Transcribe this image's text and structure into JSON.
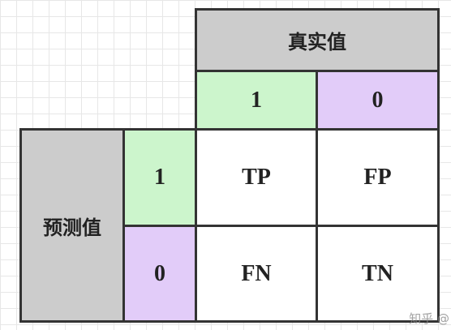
{
  "diagram": {
    "actual_header": "真实值",
    "predicted_header": "预测值",
    "actual_labels": [
      "1",
      "0"
    ],
    "predicted_labels": [
      "1",
      "0"
    ],
    "cells": {
      "tp": "TP",
      "fp": "FP",
      "fn": "FN",
      "tn": "TN"
    },
    "colors": {
      "header_fill": "#cccccc",
      "positive_fill": "#ccf5cc",
      "negative_fill": "#e2ccf9",
      "cell_fill": "#ffffff",
      "border": "#333333"
    }
  },
  "watermark": "知乎 @"
}
